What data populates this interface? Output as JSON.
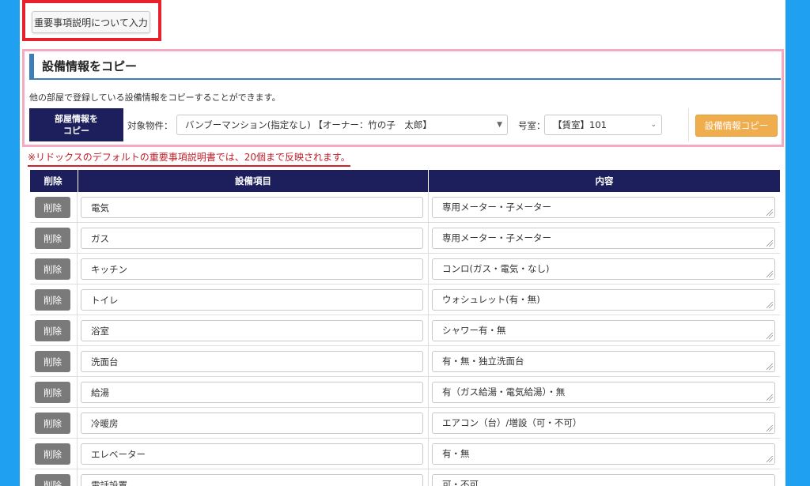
{
  "top_button": {
    "label": "重要事項説明について入力"
  },
  "copy_section": {
    "title": "設備情報をコピー",
    "description": "他の部屋で登録している設備情報をコピーすることができます。",
    "room_info_label_line1": "部屋情報を",
    "room_info_label_line2": "コピー",
    "property_label": "対象物件：",
    "property_value": "バンブーマンション(指定なし) 【オーナー：竹の子　太郎】",
    "room_no_label": "号室：",
    "room_no_value": "【賃室】101",
    "copy_button": "設備情報コピー"
  },
  "note": "※リドックスのデフォルトの重要事項説明書では、20個まで反映されます。",
  "table": {
    "headers": {
      "delete": "削除",
      "item": "設備項目",
      "content": "内容"
    },
    "delete_label": "削除",
    "rows": [
      {
        "item": "電気",
        "content": "専用メーター・子メーター"
      },
      {
        "item": "ガス",
        "content": "専用メーター・子メーター"
      },
      {
        "item": "キッチン",
        "content": "コンロ(ガス・電気・なし)"
      },
      {
        "item": "トイレ",
        "content": "ウォシュレット(有・無)"
      },
      {
        "item": "浴室",
        "content": "シャワー有・無"
      },
      {
        "item": "洗面台",
        "content": "有・無・独立洗面台"
      },
      {
        "item": "給湯",
        "content": "有（ガス給湯・電気給湯）・無"
      },
      {
        "item": "冷暖房",
        "content": "エアコン（台）/増設（可・不可）"
      },
      {
        "item": "エレベーター",
        "content": "有・無"
      },
      {
        "item": "電話設置",
        "content": "可・不可"
      }
    ]
  },
  "colors": {
    "background": "#1fa0f0",
    "header_navy": "#1c1f5c",
    "highlight_red": "#e8202a",
    "highlight_pink": "#f5a9c4",
    "copy_button": "#f0ad4e",
    "delete_button": "#7a7a7a"
  }
}
